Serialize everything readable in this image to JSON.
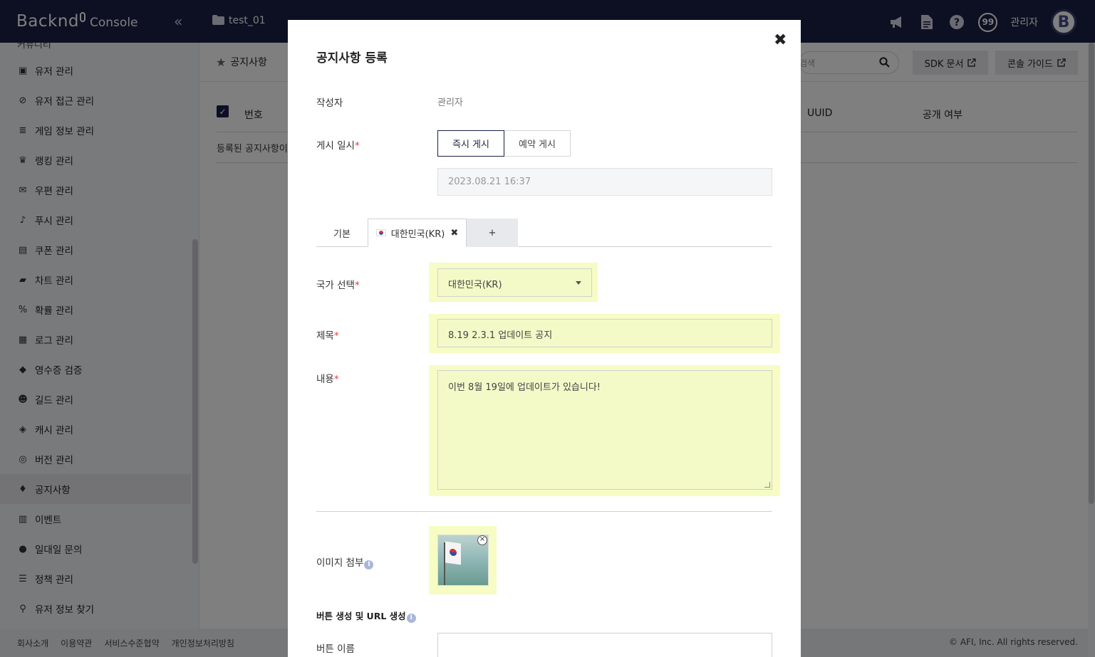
{
  "topbar": {
    "logo_main": "Backnd",
    "logo_sub": "Console",
    "collapse_icon": "«",
    "project_name": "test_01",
    "notification_badge": "99",
    "admin_name": "관리자",
    "avatar_letter": "B",
    "bg_color": "#1b2046"
  },
  "sidebar": {
    "cut_item": "커뮤니티",
    "items": [
      {
        "label": "유저 관리",
        "icon": "id-card-icon",
        "glyph": "▣"
      },
      {
        "label": "유저 접근 관리",
        "icon": "ban-icon",
        "glyph": "⊘"
      },
      {
        "label": "게임 정보 관리",
        "icon": "database-icon",
        "glyph": "≣"
      },
      {
        "label": "랭킹 관리",
        "icon": "trophy-icon",
        "glyph": "♛"
      },
      {
        "label": "우편 관리",
        "icon": "envelope-icon",
        "glyph": "✉"
      },
      {
        "label": "푸시 관리",
        "icon": "bell-icon",
        "glyph": "♪"
      },
      {
        "label": "쿠폰 관리",
        "icon": "ticket-icon",
        "glyph": "▤"
      },
      {
        "label": "차트 관리",
        "icon": "folder-open-icon",
        "glyph": "▰"
      },
      {
        "label": "확률 관리",
        "icon": "percent-icon",
        "glyph": "%"
      },
      {
        "label": "로그 관리",
        "icon": "archive-icon",
        "glyph": "▦"
      },
      {
        "label": "영수증 검증",
        "icon": "tags-icon",
        "glyph": "◆"
      },
      {
        "label": "길드 관리",
        "icon": "users-icon",
        "glyph": "☻"
      },
      {
        "label": "캐시 관리",
        "icon": "gem-icon",
        "glyph": "◈"
      },
      {
        "label": "버전 관리",
        "icon": "gamepad-icon",
        "glyph": "◎"
      },
      {
        "label": "공지사항",
        "icon": "microphone-icon",
        "glyph": "♦",
        "active": true
      },
      {
        "label": "이벤트",
        "icon": "gift-icon",
        "glyph": "▥"
      },
      {
        "label": "일대일 문의",
        "icon": "comment-icon",
        "glyph": "●"
      },
      {
        "label": "정책 관리",
        "icon": "list-check-icon",
        "glyph": "☰"
      },
      {
        "label": "유저 정보 찾기",
        "icon": "search-icon",
        "glyph": "⚲"
      }
    ]
  },
  "main": {
    "breadcrumb": "공지사항",
    "search_placeholder": "검색",
    "sdk_docs_label": "SDK 문서",
    "console_guide_label": "콘솔 가이드",
    "table_headers": [
      "번호",
      "UUID",
      "공개 여부"
    ],
    "empty_message": "등록된 공지사항이"
  },
  "footer": {
    "links": [
      "회사소개",
      "이용약관",
      "서비스수준협약",
      "개인정보처리방침"
    ],
    "copyright": "© AFI, Inc. All rights reserved."
  },
  "modal": {
    "title": "공지사항 등록",
    "close_icon": "✖",
    "author_label": "작성자",
    "author_value": "관리자",
    "post_date_label": "게시 일시",
    "immediate_label": "즉시 게시",
    "scheduled_label": "예약 게시",
    "datetime_value": "2023.08.21 16:37",
    "tabs": {
      "base": "기본",
      "kr": "대한민국(KR)",
      "add": "+"
    },
    "country_label": "국가 선택",
    "country_value": "대한민국(KR)",
    "title_label": "제목",
    "title_value": "8.19 2.3.1 업데이트 공지",
    "content_label": "내용",
    "content_value": "이번 8월 19일에 업데이트가 있습니다!",
    "image_label": "이미지 첨부",
    "button_section": "버튼 생성 및 URL 생성",
    "button_name_label": "버튼 이름",
    "required_mark": "*",
    "highlight_color": "#f6fcc3"
  }
}
